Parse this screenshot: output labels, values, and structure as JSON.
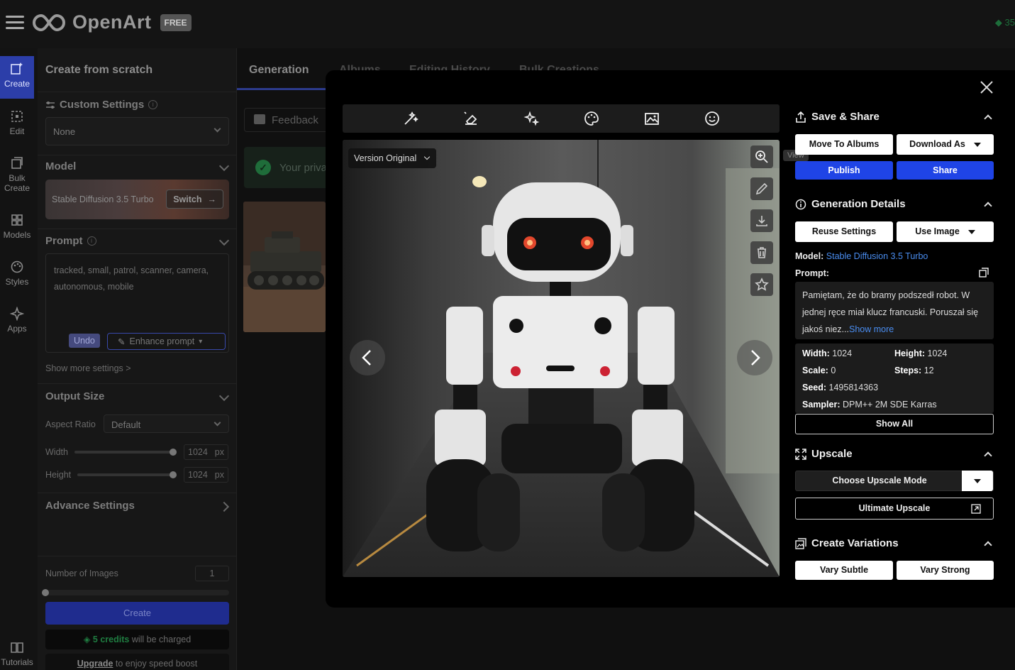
{
  "app": {
    "name": "OpenArt",
    "plan_badge": "FREE",
    "credits_partial": "35"
  },
  "rail": [
    {
      "label": "Create",
      "icon": "create-icon",
      "active": true
    },
    {
      "label": "Edit",
      "icon": "edit-icon"
    },
    {
      "label": "Bulk Create",
      "icon": "bulk-create-icon"
    },
    {
      "label": "Models",
      "icon": "models-icon"
    },
    {
      "label": "Styles",
      "icon": "styles-icon"
    },
    {
      "label": "Apps",
      "icon": "apps-icon"
    },
    {
      "label": "Tutorials",
      "icon": "tutorials-icon"
    }
  ],
  "panel": {
    "title": "Create from scratch",
    "custom_settings": {
      "label": "Custom Settings",
      "value": "None"
    },
    "model": {
      "label": "Model",
      "name": "Stable Diffusion 3.5 Turbo",
      "switch_label": "Switch"
    },
    "prompt": {
      "label": "Prompt",
      "text": "tracked, small, patrol, scanner, camera, autonomous, mobile",
      "undo_label": "Undo",
      "enhance_label": "Enhance prompt"
    },
    "show_more": "Show more settings >",
    "output_size": {
      "label": "Output Size",
      "aspect_label": "Aspect Ratio",
      "aspect_value": "Default",
      "width_label": "Width",
      "width_value": "1024",
      "height_label": "Height",
      "height_value": "1024",
      "unit": "px"
    },
    "advance_settings": "Advance Settings",
    "num_images_label": "Number of Images",
    "num_images_value": "1",
    "create_label": "Create",
    "credits_amount": "5 credits",
    "credits_suffix": "will be charged",
    "upgrade_link": "Upgrade",
    "upgrade_suffix": "to enjoy speed boost"
  },
  "main": {
    "tabs": [
      "Generation",
      "Albums",
      "Editing History",
      "Bulk Creations"
    ],
    "feedback_label": "Feedback",
    "privacy_text": "Your priva"
  },
  "modal": {
    "version_label": "Version Original",
    "view_tooltip": "View",
    "save_share": {
      "title": "Save & Share",
      "move_albums": "Move To Albums",
      "download_as": "Download As",
      "publish": "Publish",
      "share": "Share"
    },
    "details": {
      "title": "Generation Details",
      "reuse": "Reuse Settings",
      "use_image": "Use Image",
      "model_label": "Model:",
      "model_value": "Stable Diffusion 3.5 Turbo",
      "prompt_label": "Prompt:",
      "prompt_text": "Pamiętam, że do bramy podszedł robot. W jednej ręce miał klucz francuski. Poruszał się jakoś niez...",
      "show_more": "Show more",
      "width_label": "Width:",
      "width_value": "1024",
      "height_label": "Height:",
      "height_value": "1024",
      "scale_label": "Scale:",
      "scale_value": "0",
      "steps_label": "Steps:",
      "steps_value": "12",
      "seed_label": "Seed:",
      "seed_value": "1495814363",
      "sampler_label": "Sampler:",
      "sampler_value": "DPM++ 2M SDE Karras",
      "show_all": "Show All"
    },
    "upscale": {
      "title": "Upscale",
      "mode_label": "Choose Upscale Mode",
      "ultimate": "Ultimate Upscale"
    },
    "variations": {
      "title": "Create Variations",
      "subtle": "Vary Subtle",
      "strong": "Vary Strong"
    }
  },
  "colors": {
    "accent_blue": "#1f44e6",
    "link_blue": "#4a8df0",
    "credit_green": "#1f7d41"
  }
}
